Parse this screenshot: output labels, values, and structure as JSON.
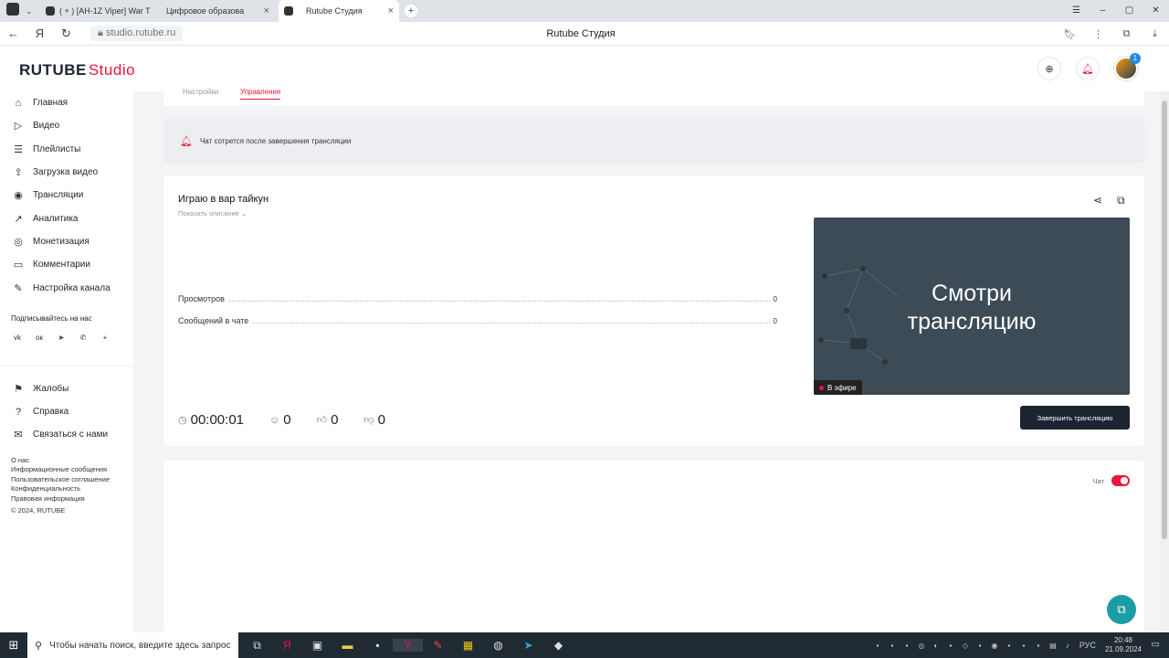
{
  "browser": {
    "tabs": [
      {
        "label": "( + ) [AH-1Z Viper] War T",
        "active": false
      },
      {
        "label": "Цифровое образова",
        "active": false
      },
      {
        "label": "Rutube Студия",
        "active": true
      }
    ],
    "url": "studio.rutube.ru",
    "page_title": "Rutube Студия"
  },
  "header": {
    "logo_main": "RUTUBE",
    "logo_sub": "Studio",
    "notification_count": "1"
  },
  "sidebar": {
    "items": [
      {
        "label": "Главная",
        "icon": "home-icon"
      },
      {
        "label": "Видео",
        "icon": "video-icon"
      },
      {
        "label": "Плейлисты",
        "icon": "playlist-icon"
      },
      {
        "label": "Загрузка видео",
        "icon": "upload-icon"
      },
      {
        "label": "Трансляции",
        "icon": "broadcast-icon"
      },
      {
        "label": "Аналитика",
        "icon": "analytics-icon"
      },
      {
        "label": "Монетизация",
        "icon": "monetization-icon"
      },
      {
        "label": "Комментарии",
        "icon": "comments-icon"
      },
      {
        "label": "Настройка канала",
        "icon": "channel-settings-icon"
      }
    ],
    "subscribe_title": "Подписывайтесь на нас",
    "socials": [
      "vk-icon",
      "ok-icon",
      "telegram-icon",
      "viber-icon",
      "plus-icon"
    ],
    "support_items": [
      {
        "label": "Жалобы",
        "icon": "flag-icon"
      },
      {
        "label": "Справка",
        "icon": "help-icon"
      },
      {
        "label": "Связаться с нами",
        "icon": "contact-icon"
      }
    ],
    "footer_links": [
      "О нас",
      "Информационные сообщения",
      "Пользовательское соглашение",
      "Конфиденциальность",
      "Правовая информация"
    ],
    "copyright": "© 2024, RUTUBE"
  },
  "main": {
    "tabs": {
      "settings": "Настройки",
      "manage": "Управление"
    },
    "notice": "Чат сотрется после завершения трансляции",
    "stream": {
      "title": "Играю в вар тайкун",
      "show_description": "Показать описание",
      "stats": [
        {
          "label": "Просмотров",
          "value": "0"
        },
        {
          "label": "Сообщений в чате",
          "value": "0"
        }
      ],
      "preview_text_line1": "Смотри",
      "preview_text_line2": "трансляцию",
      "live_label": "В эфире",
      "duration": "00:00:01",
      "viewers": "0",
      "likes": "0",
      "dislikes": "0",
      "end_button": "Завершить трансляцию"
    },
    "chat": {
      "label": "Чат",
      "enabled": true
    }
  },
  "taskbar": {
    "search_placeholder": "Чтобы начать поиск, введите здесь запрос",
    "language": "РУС",
    "time": "20:48",
    "date": "21.09.2024"
  },
  "colors": {
    "accent": "#ed143b",
    "dark": "#1c2331",
    "help": "#1a9ea3"
  }
}
